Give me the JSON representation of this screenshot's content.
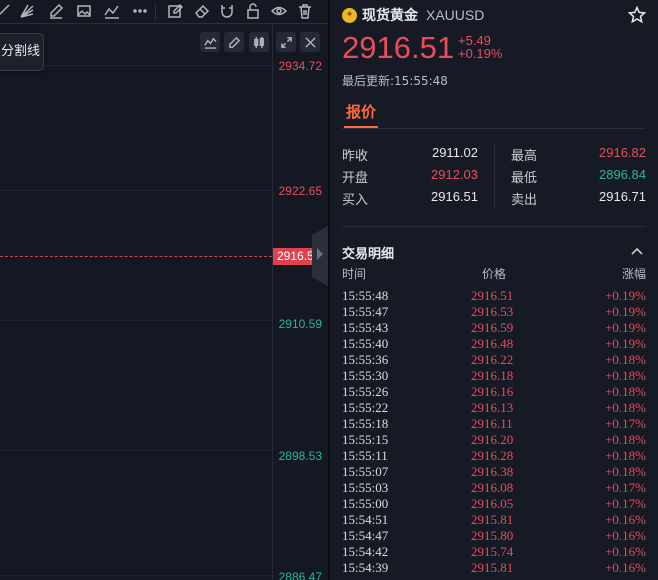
{
  "chart": {
    "tooltip_text": "分割线",
    "current_price_tag": "2916.51",
    "axis_ticks": [
      {
        "label": "2934.72",
        "dir": "up"
      },
      {
        "label": "2922.65",
        "dir": "up"
      },
      {
        "label": "2910.59",
        "dir": "down"
      },
      {
        "label": "2898.53",
        "dir": "down"
      },
      {
        "label": "2886.47",
        "dir": "down"
      }
    ],
    "toolbar_icons": [
      "line-tool-icon",
      "fib-tool-icon",
      "pencil-icon",
      "image-icon",
      "trend-icon",
      "more-icon",
      "edit-note-icon",
      "eraser-icon",
      "magnet-icon",
      "lock-icon",
      "eye-icon",
      "trash-icon"
    ],
    "mini_buttons": [
      "indicator-icon",
      "draw-icon",
      "candles-icon",
      "expand-icon",
      "close-icon"
    ]
  },
  "quote": {
    "name": "现货黄金",
    "code": "XAUUSD",
    "price": "2916.51",
    "change_abs": "+5.49",
    "change_pct": "+0.19%",
    "update_label": "最后更新:15:55:48",
    "tab_label": "报价",
    "accent_color": "#ff6a3d",
    "up_color": "#e84d5b",
    "down_color": "#2bb596"
  },
  "stats": {
    "prev_close_label": "昨收",
    "prev_close": "2911.02",
    "high_label": "最高",
    "high": "2916.82",
    "open_label": "开盘",
    "open": "2912.03",
    "low_label": "最低",
    "low": "2896.84",
    "bid_label": "买入",
    "bid": "2916.51",
    "ask_label": "卖出",
    "ask": "2916.71"
  },
  "trades": {
    "title": "交易明细",
    "col_time": "时间",
    "col_price": "价格",
    "col_change": "涨幅",
    "rows": [
      [
        "15:55:48",
        "2916.51",
        "+0.19%"
      ],
      [
        "15:55:47",
        "2916.53",
        "+0.19%"
      ],
      [
        "15:55:43",
        "2916.59",
        "+0.19%"
      ],
      [
        "15:55:40",
        "2916.48",
        "+0.19%"
      ],
      [
        "15:55:36",
        "2916.22",
        "+0.18%"
      ],
      [
        "15:55:30",
        "2916.18",
        "+0.18%"
      ],
      [
        "15:55:26",
        "2916.16",
        "+0.18%"
      ],
      [
        "15:55:22",
        "2916.13",
        "+0.18%"
      ],
      [
        "15:55:18",
        "2916.11",
        "+0.17%"
      ],
      [
        "15:55:15",
        "2916.20",
        "+0.18%"
      ],
      [
        "15:55:11",
        "2916.28",
        "+0.18%"
      ],
      [
        "15:55:07",
        "2916.38",
        "+0.18%"
      ],
      [
        "15:55:03",
        "2916.08",
        "+0.17%"
      ],
      [
        "15:55:00",
        "2916.05",
        "+0.17%"
      ],
      [
        "15:54:51",
        "2915.81",
        "+0.16%"
      ],
      [
        "15:54:47",
        "2915.80",
        "+0.16%"
      ],
      [
        "15:54:42",
        "2915.74",
        "+0.16%"
      ],
      [
        "15:54:39",
        "2915.81",
        "+0.16%"
      ]
    ]
  }
}
